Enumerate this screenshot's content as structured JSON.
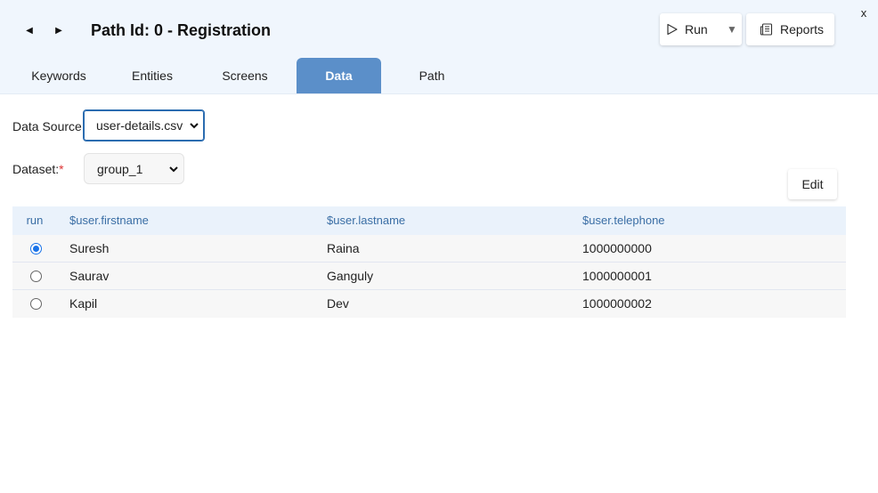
{
  "header": {
    "title": "Path Id: 0 - Registration",
    "prev_glyph": "◀",
    "next_glyph": "▶",
    "close_label": "x",
    "run_label": "Run",
    "run_dropdown_glyph": "▼",
    "reports_label": "Reports"
  },
  "tabs": [
    {
      "label": "Keywords",
      "active": false
    },
    {
      "label": "Entities",
      "active": false
    },
    {
      "label": "Screens",
      "active": false
    },
    {
      "label": "Data",
      "active": true
    },
    {
      "label": "Path",
      "active": false
    }
  ],
  "form": {
    "data_source_label": "Data Source:",
    "data_source_value": "user-details.csv",
    "dataset_label": "Dataset:",
    "dataset_required_mark": "*",
    "dataset_value": "group_1",
    "edit_label": "Edit"
  },
  "table": {
    "columns": [
      "run",
      "$user.firstname",
      "$user.lastname",
      "$user.telephone"
    ],
    "rows": [
      {
        "selected": true,
        "firstname": "Suresh",
        "lastname": "Raina",
        "telephone": "1000000000"
      },
      {
        "selected": false,
        "firstname": "Saurav",
        "lastname": "Ganguly",
        "telephone": "1000000001"
      },
      {
        "selected": false,
        "firstname": "Kapil",
        "lastname": "Dev",
        "telephone": "1000000002"
      }
    ]
  },
  "colors": {
    "header_bg": "#f0f6fd",
    "active_tab": "#5b8fc9",
    "table_header_bg": "#eaf2fb",
    "table_header_text": "#3a6ea5",
    "radio_selected": "#1a73e8",
    "required": "#dd3333"
  },
  "icons": {
    "run": "play-outline-icon",
    "reports": "report-document-icon",
    "select_caret": "chevron-down-icon"
  }
}
